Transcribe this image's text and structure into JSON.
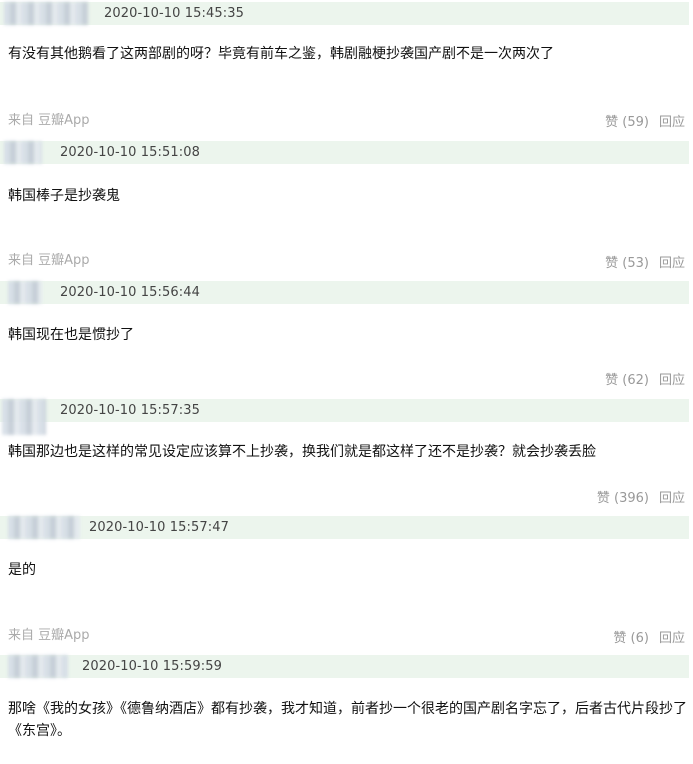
{
  "comments": [
    {
      "timestamp": "2020-10-10 15:45:35",
      "text": "有没有其他鹅看了这两部剧的呀？毕竟有前车之鉴，韩剧融梗抄袭国产剧不是一次两次了",
      "source": "来自 豆瓣App",
      "like_label": "赞 (59)",
      "reply_label": "回应"
    },
    {
      "timestamp": "2020-10-10 15:51:08",
      "text": "韩国棒子是抄袭鬼",
      "source": "来自 豆瓣App",
      "like_label": "赞 (53)",
      "reply_label": "回应"
    },
    {
      "timestamp": "2020-10-10 15:56:44",
      "text": "韩国现在也是惯抄了",
      "source": "",
      "like_label": "赞 (62)",
      "reply_label": "回应"
    },
    {
      "timestamp": "2020-10-10 15:57:35",
      "text": "韩国那边也是这样的常见设定应该算不上抄袭，换我们就是都这样了还不是抄袭？就会抄袭丢脸",
      "source": "",
      "like_label": "赞 (396)",
      "reply_label": "回应"
    },
    {
      "timestamp": "2020-10-10 15:57:47",
      "text": "是的",
      "source": "来自 豆瓣App",
      "like_label": "赞 (6)",
      "reply_label": "回应"
    },
    {
      "timestamp": "2020-10-10 15:59:59",
      "text": "那啥《我的女孩》《德鲁纳酒店》都有抄袭，我才知道，前者抄一个很老的国产剧名字忘了，后者古代片段抄了《东宫》。",
      "source": "",
      "like_label": "",
      "reply_label": ""
    }
  ]
}
